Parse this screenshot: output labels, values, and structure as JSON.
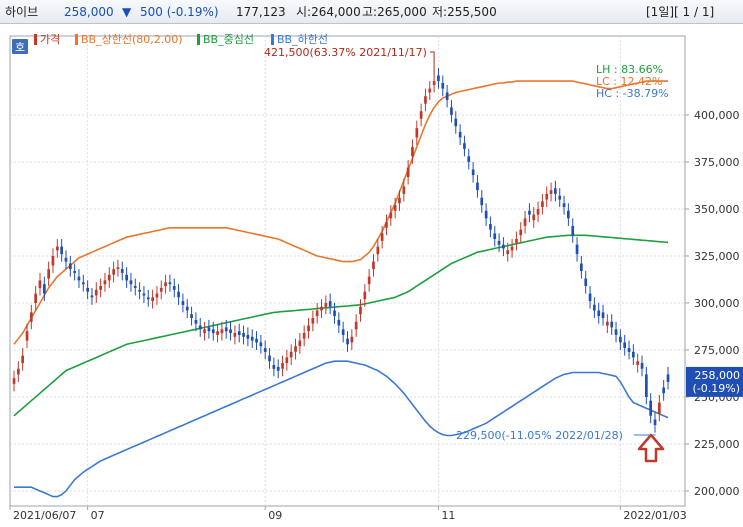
{
  "header": {
    "stock_name": "하이브",
    "price": "258,000",
    "change_arrow": "▼",
    "change": "500 (-0.19%)",
    "volume": "177,123",
    "open": "시:264,000",
    "high": "고:265,000",
    "low": "저:255,500",
    "page_indicator": "[1일][ 1 / 1]"
  },
  "chart_icon": {
    "label": "호"
  },
  "legend": [
    {
      "label": "가격",
      "color": "#c0392b"
    },
    {
      "label": "BB_상한선(80,2.00)",
      "color": "#e8762d"
    },
    {
      "label": "BB_중심선",
      "color": "#1e9e3e"
    },
    {
      "label": "BB_하한선",
      "color": "#3a78d6"
    }
  ],
  "stats": {
    "lh": "LH :  83.66%",
    "lc": "LC :  12.42%",
    "hc": "HC : -38.79%"
  },
  "colors": {
    "up": "#c0392b",
    "down": "#1f4fb5",
    "upper_band": "#e8762d",
    "middle_band": "#1e9e3e",
    "lower_band": "#3a78d6",
    "arrow": "#c0392b",
    "price_tag": "#1f4fb5"
  },
  "chart_data": {
    "type": "candlestick",
    "title": "",
    "ylim": [
      192000,
      442000
    ],
    "y_ticks": [
      200000,
      225000,
      250000,
      275000,
      300000,
      325000,
      350000,
      375000,
      400000
    ],
    "y_tick_labels": [
      "200,000",
      "225,000",
      "250,000",
      "275,000",
      "300,000",
      "325,000",
      "350,000",
      "375,000",
      "400,000"
    ],
    "x_tick_labels": [
      {
        "label": "2021/06/07",
        "index": 0
      },
      {
        "label": "07",
        "index": 17
      },
      {
        "label": "09",
        "index": 58
      },
      {
        "label": "11",
        "index": 98
      },
      {
        "label": "2022/01/03",
        "index": 140
      }
    ],
    "annotations": {
      "high": {
        "label": "421,500(63.37% 2021/11/17)",
        "value": 421500
      },
      "low": {
        "label": "229,500(-11.05% 2022/01/28)",
        "value": 229500
      }
    },
    "last_price": {
      "label": "258,000",
      "change": "(-0.19%)",
      "value": 258000
    },
    "close": [
      260000,
      265000,
      272000,
      285000,
      295000,
      305000,
      312000,
      305000,
      318000,
      325000,
      330000,
      326000,
      322000,
      318000,
      316000,
      312000,
      310000,
      306000,
      303000,
      307000,
      309000,
      312000,
      315000,
      318000,
      319000,
      316000,
      312000,
      310000,
      308000,
      306000,
      304000,
      302000,
      303000,
      305000,
      308000,
      311000,
      310000,
      307000,
      303000,
      299000,
      296000,
      292000,
      289000,
      286000,
      286000,
      285000,
      284000,
      285000,
      286000,
      285000,
      284000,
      284000,
      283000,
      282000,
      281000,
      280000,
      279000,
      277000,
      274000,
      269000,
      265000,
      264000,
      268000,
      271000,
      274000,
      277000,
      280000,
      284000,
      288000,
      292000,
      296000,
      298000,
      300000,
      298000,
      293000,
      288000,
      283000,
      278000,
      282000,
      290000,
      298000,
      306000,
      314000,
      322000,
      330000,
      337000,
      343000,
      348000,
      352000,
      356000,
      362000,
      372000,
      383000,
      393000,
      402000,
      410000,
      414000,
      418000,
      418000,
      414000,
      408000,
      400000,
      394000,
      388000,
      382000,
      375000,
      368000,
      360000,
      352000,
      345000,
      339000,
      334000,
      331000,
      329000,
      328000,
      330000,
      334000,
      339000,
      345000,
      347000,
      347000,
      350000,
      354000,
      358000,
      360000,
      358000,
      355000,
      351000,
      345000,
      336000,
      326000,
      317000,
      309000,
      301000,
      296000,
      293000,
      292000,
      290000,
      287000,
      283000,
      279000,
      276000,
      274000,
      271000,
      269000,
      265000,
      250000,
      240000,
      235000,
      247000,
      252000,
      258000
    ],
    "open": [
      257000,
      262000,
      268000,
      280000,
      290000,
      300000,
      308000,
      310000,
      313000,
      320000,
      328000,
      330000,
      324000,
      321000,
      317000,
      314000,
      311000,
      308000,
      304000,
      304000,
      307000,
      310000,
      312000,
      315000,
      318000,
      318000,
      315000,
      312000,
      309000,
      307000,
      305000,
      303000,
      301000,
      303000,
      306000,
      309000,
      311000,
      309000,
      306000,
      301000,
      298000,
      294000,
      291000,
      288000,
      284000,
      287000,
      286000,
      283000,
      284000,
      287000,
      286000,
      282000,
      285000,
      284000,
      283000,
      282000,
      281000,
      279000,
      276000,
      272000,
      267000,
      266000,
      265000,
      268000,
      271000,
      274000,
      277000,
      281000,
      285000,
      289000,
      293000,
      296000,
      298000,
      301000,
      296000,
      291000,
      286000,
      281000,
      279000,
      286000,
      294000,
      302000,
      310000,
      318000,
      326000,
      333000,
      340000,
      345000,
      349000,
      353000,
      358000,
      367000,
      378000,
      388000,
      398000,
      406000,
      412000,
      416000,
      421000,
      417000,
      412000,
      404000,
      398000,
      391000,
      385000,
      378000,
      371000,
      364000,
      356000,
      349000,
      342000,
      337000,
      333000,
      331000,
      326000,
      328000,
      332000,
      336000,
      341000,
      349000,
      344000,
      347000,
      351000,
      355000,
      358000,
      361000,
      357000,
      353000,
      349000,
      341000,
      331000,
      321000,
      313000,
      305000,
      299000,
      296000,
      295000,
      288000,
      290000,
      286000,
      282000,
      279000,
      276000,
      274000,
      267000,
      268000,
      262000,
      248000,
      238000,
      241000,
      255000,
      262000
    ],
    "upper_band": [
      278000,
      281000,
      284000,
      288000,
      292000,
      296000,
      300000,
      304000,
      308000,
      311000,
      314000,
      316000,
      318000,
      320000,
      322000,
      324000,
      325000,
      326000,
      327000,
      328000,
      329000,
      330000,
      331000,
      332000,
      333000,
      334000,
      335000,
      335500,
      336000,
      336500,
      337000,
      337500,
      338000,
      338500,
      339000,
      339500,
      340000,
      340000,
      340000,
      340000,
      340000,
      340000,
      340000,
      340000,
      340000,
      340000,
      340000,
      340000,
      340000,
      340000,
      339500,
      339000,
      338500,
      338000,
      337500,
      337000,
      336500,
      336000,
      335500,
      335000,
      334500,
      334000,
      333000,
      332000,
      331000,
      330000,
      329000,
      328000,
      327000,
      326000,
      325000,
      324500,
      324000,
      323500,
      323000,
      322500,
      322000,
      322000,
      322000,
      322500,
      323000,
      325000,
      327000,
      330000,
      334000,
      338000,
      343000,
      348000,
      353000,
      359000,
      365000,
      371000,
      377000,
      383000,
      389000,
      395000,
      400000,
      404000,
      407000,
      409000,
      410000,
      411000,
      412000,
      412500,
      413000,
      413500,
      414000,
      414500,
      415000,
      415500,
      416000,
      416500,
      417000,
      417000,
      417500,
      417500,
      418000,
      418000,
      418000,
      418000,
      418000,
      418000,
      418000,
      418000,
      418000,
      418000,
      418000,
      418000,
      418000,
      418000,
      417500,
      417000,
      416500,
      416000,
      415500,
      415000,
      414500,
      414000,
      414000,
      414500,
      415000,
      415500,
      416000,
      416500,
      417000,
      417500,
      418000,
      418000,
      418000,
      418000,
      418000,
      418000
    ],
    "middle_band": [
      240000,
      242000,
      244000,
      246000,
      248000,
      250000,
      252000,
      254000,
      256000,
      258000,
      260000,
      262000,
      264000,
      265000,
      266000,
      267000,
      268000,
      269000,
      270000,
      271000,
      272000,
      273000,
      274000,
      275000,
      276000,
      277000,
      278000,
      278500,
      279000,
      279500,
      280000,
      280500,
      281000,
      281500,
      282000,
      282500,
      283000,
      283500,
      284000,
      284500,
      285000,
      285500,
      286000,
      286500,
      287000,
      287500,
      288000,
      288500,
      289000,
      289500,
      290000,
      290500,
      291000,
      291500,
      292000,
      292500,
      293000,
      293500,
      294000,
      294500,
      295000,
      295200,
      295400,
      295600,
      295800,
      296000,
      296200,
      296400,
      296600,
      296800,
      297000,
      297200,
      297400,
      297600,
      297800,
      298000,
      298200,
      298400,
      298600,
      298800,
      299000,
      299500,
      300000,
      300500,
      301000,
      301500,
      302000,
      302500,
      303000,
      304000,
      305000,
      306000,
      307500,
      309000,
      310500,
      312000,
      313500,
      315000,
      316500,
      318000,
      319500,
      321000,
      322000,
      323000,
      324000,
      325000,
      326000,
      327000,
      327500,
      328000,
      328500,
      329000,
      329500,
      330000,
      330500,
      331000,
      331500,
      332000,
      332500,
      333000,
      333500,
      334000,
      334500,
      335000,
      335200,
      335400,
      335600,
      335800,
      336000,
      336000,
      336000,
      336000,
      336000,
      335800,
      335600,
      335400,
      335200,
      335000,
      334800,
      334600,
      334400,
      334200,
      334000,
      333800,
      333600,
      333400,
      333200,
      333000,
      332800,
      332600,
      332400,
      332200
    ],
    "lower_band": [
      202000,
      202000,
      202000,
      202000,
      202000,
      201000,
      200000,
      199000,
      198000,
      197000,
      197000,
      198000,
      200000,
      203000,
      206000,
      208000,
      210000,
      211500,
      213000,
      214500,
      216000,
      217000,
      218000,
      219000,
      220000,
      221000,
      222000,
      223000,
      224000,
      225000,
      226000,
      227000,
      228000,
      229000,
      230000,
      231000,
      232000,
      233000,
      234000,
      235000,
      236000,
      237000,
      238000,
      239000,
      240000,
      241000,
      242000,
      243000,
      244000,
      245000,
      246000,
      247000,
      248000,
      249000,
      250000,
      251000,
      252000,
      253000,
      254000,
      255000,
      256000,
      257000,
      258000,
      259000,
      260000,
      261000,
      262000,
      263000,
      264000,
      265000,
      266000,
      267000,
      268000,
      268500,
      269000,
      269000,
      269000,
      269000,
      268500,
      268000,
      267500,
      267000,
      266000,
      265000,
      264000,
      262500,
      261000,
      259000,
      257000,
      254500,
      252000,
      249000,
      246000,
      243000,
      240000,
      237000,
      234500,
      232500,
      231000,
      230000,
      229500,
      229500,
      230000,
      230500,
      231000,
      232000,
      233000,
      234000,
      235000,
      236000,
      237500,
      239000,
      240500,
      242000,
      243500,
      245000,
      246500,
      248000,
      249500,
      251000,
      252500,
      254000,
      255500,
      257000,
      258500,
      260000,
      261000,
      262000,
      262500,
      263000,
      263000,
      263000,
      263000,
      263000,
      263000,
      263000,
      262500,
      262000,
      261500,
      261000,
      258000,
      254000,
      250000,
      247000,
      246000,
      245000,
      244000,
      243000,
      242000,
      241000,
      240000,
      239000
    ]
  }
}
